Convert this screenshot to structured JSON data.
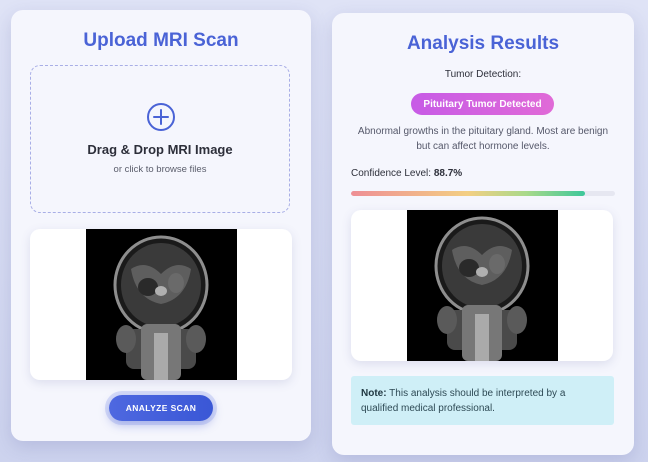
{
  "upload": {
    "title": "Upload MRI Scan",
    "drop_heading": "Drag & Drop MRI Image",
    "drop_subtext": "or click to browse files",
    "analyze_button": "ANALYZE SCAN"
  },
  "results": {
    "title": "Analysis Results",
    "detection_label": "Tumor Detection:",
    "detection_result": "Pituitary Tumor Detected",
    "description": "Abnormal growths in the pituitary gland. Most are benign but can affect hormone levels.",
    "confidence_label": "Confidence Level:",
    "confidence_value": "88.7%",
    "confidence_fraction": 0.887,
    "note_label": "Note:",
    "note_text": "This analysis should be interpreted by a qualified medical professional."
  },
  "colors": {
    "accent": "#4a63d6",
    "badge": "#d563df",
    "note_bg": "#cfeff7"
  },
  "icons": {
    "upload": "plus-circle-icon"
  }
}
